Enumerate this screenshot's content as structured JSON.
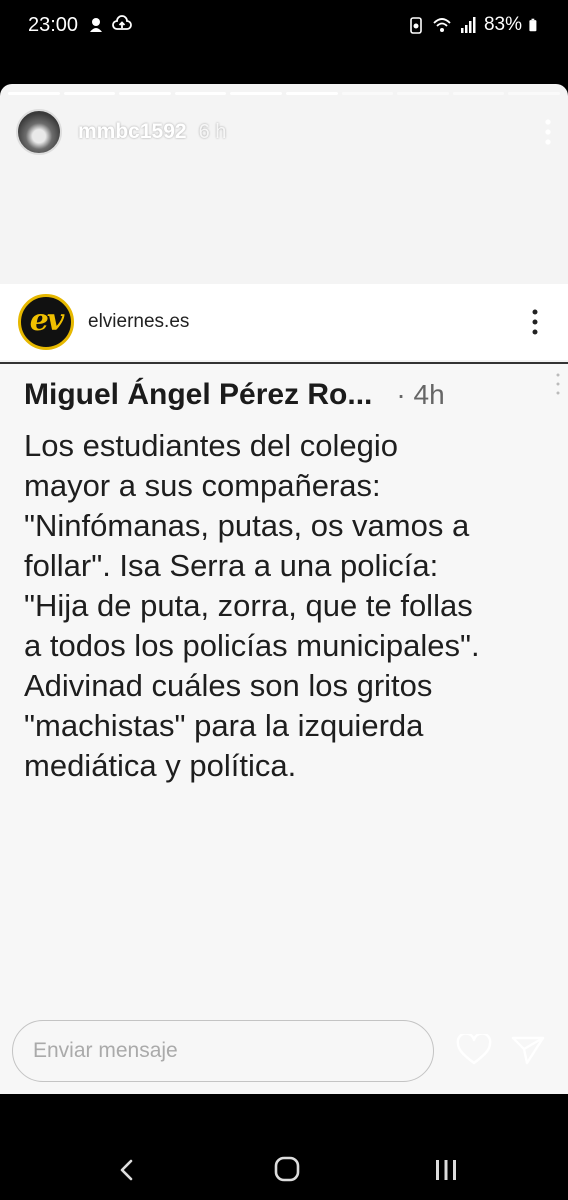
{
  "status_bar": {
    "time": "23:00",
    "battery": "83%",
    "icons": [
      "spotify-icon",
      "cloud-upload-icon",
      "battery-saver-icon",
      "wifi-icon",
      "signal-icon",
      "battery-icon"
    ]
  },
  "story": {
    "username": "mmbc1592",
    "age": "6 h",
    "progress_total": 10,
    "progress_current": 6
  },
  "post": {
    "account": "elviernes.es",
    "logo_text": "ev"
  },
  "tweet": {
    "name": "Miguel Ángel Pérez Ro...",
    "age": "· 4h",
    "text": "Los estudiantes del colegio\nmayor a sus compañeras:\n\"Ninfómanas, putas, os vamos a\nfollar\". Isa Serra a una policía:\n\"Hija de puta, zorra, que te follas\na todos los policías municipales\".\nAdivinad cuáles son los gritos\n\"machistas\" para la izquierda\nmediática y política."
  },
  "reply": {
    "placeholder": "Enviar mensaje"
  },
  "nav": {
    "icons": [
      "back-icon",
      "home-icon",
      "recents-icon"
    ]
  }
}
